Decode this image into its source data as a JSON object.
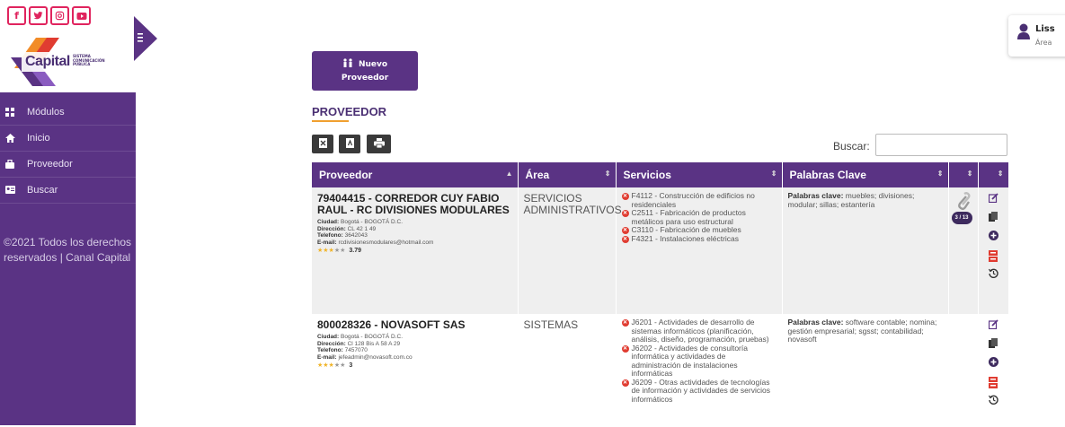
{
  "social": {
    "facebook": "f",
    "twitter": "t",
    "instagram": "◎",
    "youtube": "▶"
  },
  "logo": {
    "brand": "Capital",
    "sub": "SISTEMA COMUNICACIÓN PÚBLICA"
  },
  "sidebar": {
    "items": [
      {
        "label": "Módulos",
        "icon": "grid-icon"
      },
      {
        "label": "Inicio",
        "icon": "home-icon"
      },
      {
        "label": "Proveedor",
        "icon": "briefcase-icon"
      },
      {
        "label": "Buscar",
        "icon": "id-card-icon"
      }
    ],
    "footer": "©2021 Todos los derechos reservados | Canal Capital"
  },
  "user": {
    "name": "Liss",
    "area": "Área"
  },
  "toolbar": {
    "new_button_line1": "Nuevo",
    "new_button_line2": "Proveedor",
    "search_label": "Buscar:",
    "search_value": ""
  },
  "page": {
    "title": "PROVEEDOR"
  },
  "table": {
    "headers": [
      "Proveedor",
      "Área",
      "Servicios",
      "Palabras Clave",
      "",
      ""
    ],
    "rows": [
      {
        "name": "79404415 - CORREDOR CUY FABIO RAUL - RC DIVISIONES MODULARES",
        "ciudad_label": "Ciudad:",
        "ciudad": "Bogotá - BOGOTÁ D.C.",
        "direccion_label": "Dirección:",
        "direccion": "CL 42 1 49",
        "telefono_label": "Telefono:",
        "telefono": "3642043",
        "email_label": "E-mail:",
        "email": "rcdivisionesmodulares@hotmail.com",
        "stars": 3,
        "rating": "3.79",
        "area": "SERVICIOS ADMINISTRATIVOS",
        "services": [
          "F4112 - Construcción de edificios no residenciales",
          "C2511 - Fabricación de productos metálicos para uso estructural",
          "C3110 - Fabricación de muebles",
          "F4321 - Instalaciones eléctricas"
        ],
        "keywords_label": "Palabras clave:",
        "keywords": "muebles; divisiones; modular; sillas; estantería",
        "attachments": "3 / 13"
      },
      {
        "name": "800028326 - NOVASOFT SAS",
        "ciudad_label": "Ciudad:",
        "ciudad": "Bogotá - BOGOTÁ D.C.",
        "direccion_label": "Dirección:",
        "direccion": "Cl 128 Bis A 58 A 29",
        "telefono_label": "Telefono:",
        "telefono": "7457070",
        "email_label": "E-mail:",
        "email": "jefeadmin@novasoft.com.co",
        "stars": 3,
        "rating": "3",
        "area": "SISTEMAS",
        "services": [
          "J6201 - Actividades de desarrollo de sistemas informáticos (planificación, análisis, diseño, programación, pruebas)",
          "J6202 - Actividades de consultoría informática y actividades de administración de instalaciones informáticas",
          "J6209 - Otras actividades de tecnologías de información y actividades de servicios informáticos"
        ],
        "keywords_label": "Palabras clave:",
        "keywords": "software contable; nomina; gestión empresarial; sgsst; contabilidad; novasoft",
        "attachments": ""
      }
    ]
  },
  "colors": {
    "primary": "#5a3384",
    "accent": "#f0a030",
    "danger": "#e03c31"
  }
}
